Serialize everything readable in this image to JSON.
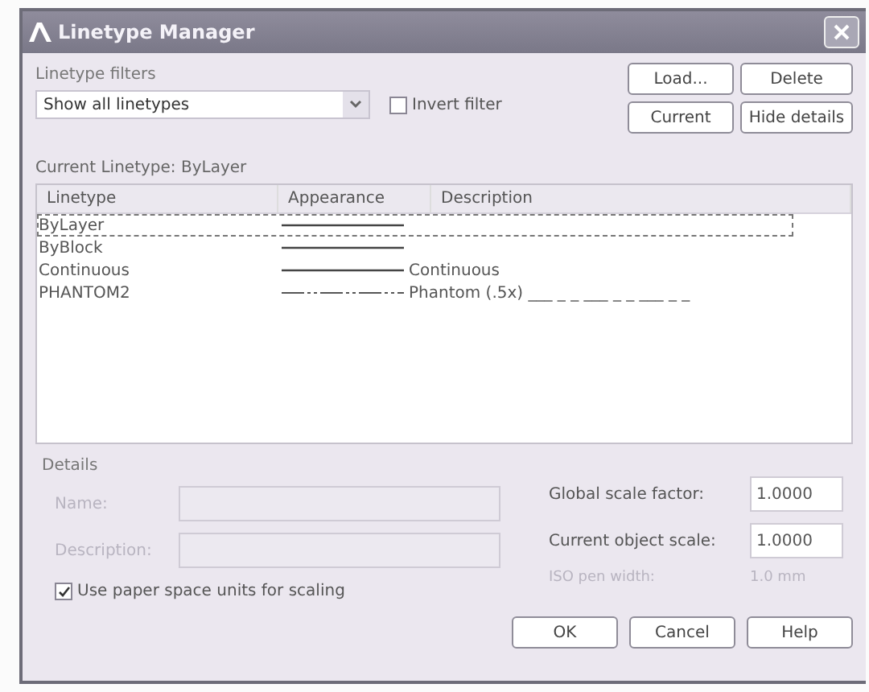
{
  "window": {
    "title": "Linetype Manager"
  },
  "filter": {
    "label": "Linetype filters",
    "value": "Show all linetypes",
    "invert_label": "Invert filter",
    "invert_checked": false
  },
  "buttons_top": [
    {
      "label": "Load..."
    },
    {
      "label": "Delete"
    },
    {
      "label": "Current"
    },
    {
      "label": "Hide details"
    }
  ],
  "current_linetype": "Current Linetype:  ByLayer",
  "table": {
    "columns": [
      "Linetype",
      "Appearance",
      "Description"
    ],
    "rows": [
      {
        "linetype": "ByLayer",
        "kind": "solid",
        "description": "",
        "selected": true
      },
      {
        "linetype": "ByBlock",
        "kind": "solid",
        "description": "",
        "selected": false
      },
      {
        "linetype": "Continuous",
        "kind": "solid",
        "description": "Continuous",
        "selected": false
      },
      {
        "linetype": "PHANTOM2",
        "kind": "phantom",
        "description": "Phantom (.5x) ___ _ _ ___ _ _ ___ _ _",
        "selected": false
      }
    ]
  },
  "details": {
    "title": "Details",
    "name_label": "Name:",
    "description_label": "Description:",
    "disabled": true,
    "global_scale_label": "Global scale factor:",
    "global_scale": "1.0000",
    "object_scale_label": "Current object scale:",
    "object_scale": "1.0000",
    "paper_space_label": "Use paper space units for scaling",
    "paper_space_checked": true,
    "pen_width_label": "ISO pen width:",
    "pen_width": "1.0 mm"
  },
  "buttons_bottom": [
    {
      "label": "OK"
    },
    {
      "label": "Cancel"
    },
    {
      "label": "Help"
    }
  ]
}
